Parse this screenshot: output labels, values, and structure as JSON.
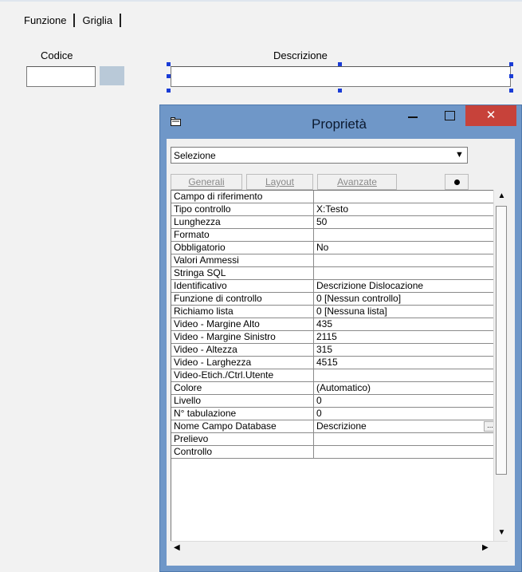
{
  "tabs": [
    {
      "label": "Funzione"
    },
    {
      "label": "Griglia"
    }
  ],
  "form": {
    "codice_label": "Codice",
    "descrizione_label": "Descrizione"
  },
  "window": {
    "title": "Proprietà",
    "minimize_icon": "minimize-icon",
    "maximize_icon": "maximize-icon",
    "close_glyph": "✕",
    "accent": "#6f97c8",
    "close_color": "#c7423a"
  },
  "selector": {
    "value": "Selezione",
    "arrow_glyph": "▼"
  },
  "toolbar": {
    "generali": "Generali",
    "layout": "Layout",
    "avanzate": "Avanzate"
  },
  "properties": [
    {
      "name": "Campo di riferimento",
      "value": ""
    },
    {
      "name": "Tipo controllo",
      "value": "X:Testo"
    },
    {
      "name": "Lunghezza",
      "value": "50"
    },
    {
      "name": "Formato",
      "value": ""
    },
    {
      "name": "Obbligatorio",
      "value": "No"
    },
    {
      "name": "Valori Ammessi",
      "value": ""
    },
    {
      "name": "Stringa SQL",
      "value": ""
    },
    {
      "name": "Identificativo",
      "value": "Descrizione Dislocazione"
    },
    {
      "name": "Funzione di controllo",
      "value": "0 [Nessun controllo]"
    },
    {
      "name": "Richiamo lista",
      "value": "0 [Nessuna lista]"
    },
    {
      "name": "Video - Margine Alto",
      "value": "435"
    },
    {
      "name": "Video - Margine Sinistro",
      "value": "2115"
    },
    {
      "name": "Video - Altezza",
      "value": "315"
    },
    {
      "name": "Video - Larghezza",
      "value": "4515"
    },
    {
      "name": "Video-Etich./Ctrl.Utente",
      "value": ""
    },
    {
      "name": "Colore",
      "value": "(Automatico)"
    },
    {
      "name": "Livello",
      "value": "0"
    },
    {
      "name": "N° tabulazione",
      "value": "0"
    },
    {
      "name": "Nome Campo Database",
      "value": "Descrizione",
      "ellipsis": "..."
    },
    {
      "name": "Prelievo",
      "value": ""
    },
    {
      "name": "Controllo",
      "value": ""
    }
  ],
  "scroll": {
    "up": "▲",
    "down": "▼",
    "left": "◀",
    "right": "▶"
  }
}
